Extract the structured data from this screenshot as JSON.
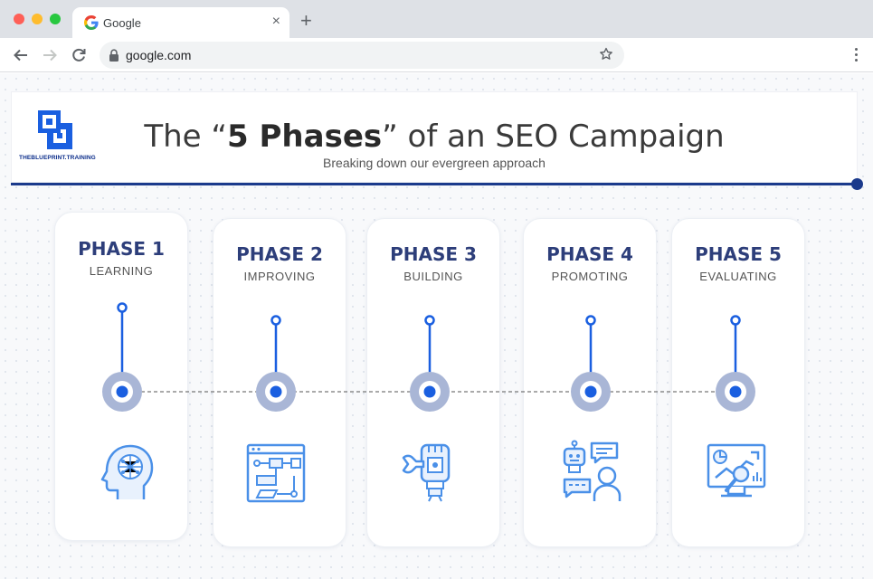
{
  "browser": {
    "tab_title": "Google",
    "new_tab_label": "+",
    "close_label": "×",
    "url": "google.com"
  },
  "infographic": {
    "logo_text": "THEBLUEPRINT.TRAINING",
    "title_prefix": "The “",
    "title_bold": "5 Phases",
    "title_suffix": "” of an SEO Campaign",
    "subtitle": "Breaking down our evergreen approach",
    "colors": {
      "navy": "#1b3a8c",
      "accent": "#1a5fe0",
      "ring": "#a9b6d6",
      "icon": "#4a90e8"
    },
    "phases": [
      {
        "title": "PHASE 1",
        "subtitle": "LEARNING",
        "icon": "brain-head-icon"
      },
      {
        "title": "PHASE 2",
        "subtitle": "IMPROVING",
        "icon": "flowchart-window-icon"
      },
      {
        "title": "PHASE 3",
        "subtitle": "BUILDING",
        "icon": "robot-arm-wrench-icon"
      },
      {
        "title": "PHASE 4",
        "subtitle": "PROMOTING",
        "icon": "bot-and-person-chat-icon"
      },
      {
        "title": "PHASE 5",
        "subtitle": "EVALUATING",
        "icon": "analytics-monitor-icon"
      }
    ]
  }
}
